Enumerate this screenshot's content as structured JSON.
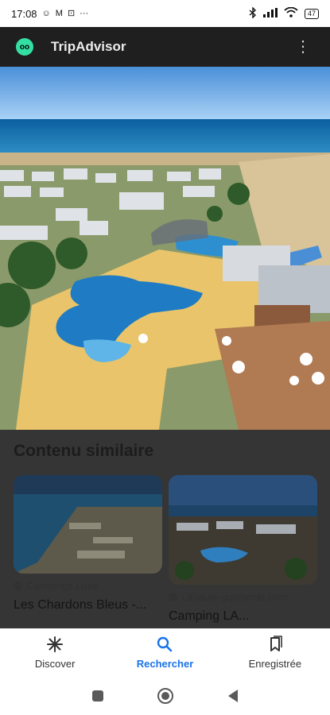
{
  "status_bar": {
    "time": "17:08",
    "battery": "47",
    "overflow_label": "···"
  },
  "header": {
    "app_name": "TripAdvisor",
    "logo_text": "oo"
  },
  "section": {
    "title": "Contenu similaire"
  },
  "cards": [
    {
      "source": "Campings.Luxe",
      "title": "Les Chardons Bleus -..."
    },
    {
      "source": "Labaule-guerande.com",
      "title": "Camping LA..."
    }
  ],
  "bottom_nav": [
    {
      "label": "Discover",
      "icon": "asterisk-icon",
      "active": false
    },
    {
      "label": "Rechercher",
      "icon": "search-icon",
      "active": true
    },
    {
      "label": "Enregistrée",
      "icon": "bookmarks-icon",
      "active": false
    }
  ],
  "colors": {
    "accent": "#1a73e8",
    "logo_green": "#34e0a1"
  }
}
